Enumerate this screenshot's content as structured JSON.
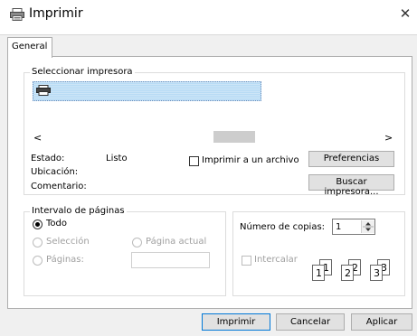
{
  "window": {
    "title": "Imprimir",
    "close_glyph": "✕"
  },
  "tabs": [
    {
      "label": "General"
    }
  ],
  "select_printer": {
    "legend": "Seleccionar impresora",
    "scroll_left": "<",
    "scroll_right": ">",
    "status_label": "Estado:",
    "status_value": "Listo",
    "location_label": "Ubicación:",
    "comment_label": "Comentario:",
    "print_to_file_label": "Imprimir a un archivo",
    "print_to_file_checked": false,
    "preferences_button": "Preferencias",
    "find_printer_button": "Buscar impresora..."
  },
  "page_range": {
    "legend": "Intervalo de páginas",
    "all_label": "Todo",
    "selection_label": "Selección",
    "current_page_label": "Página actual",
    "pages_label": "Páginas:",
    "pages_value": "",
    "selected": "Todo"
  },
  "copies": {
    "label": "Número de copias:",
    "value": "1",
    "collate_label": "Intercalar",
    "collate_checked": false,
    "collate_pages": [
      "1",
      "1",
      "2",
      "2",
      "3",
      "3"
    ]
  },
  "footer": {
    "print_button": "Imprimir",
    "cancel_button": "Cancelar",
    "apply_button": "Aplicar"
  },
  "icons": {
    "title_icon": "printer-icon",
    "printer_list_icon": "printer-icon",
    "spinner_icon": "spinner-arrows-icon"
  }
}
